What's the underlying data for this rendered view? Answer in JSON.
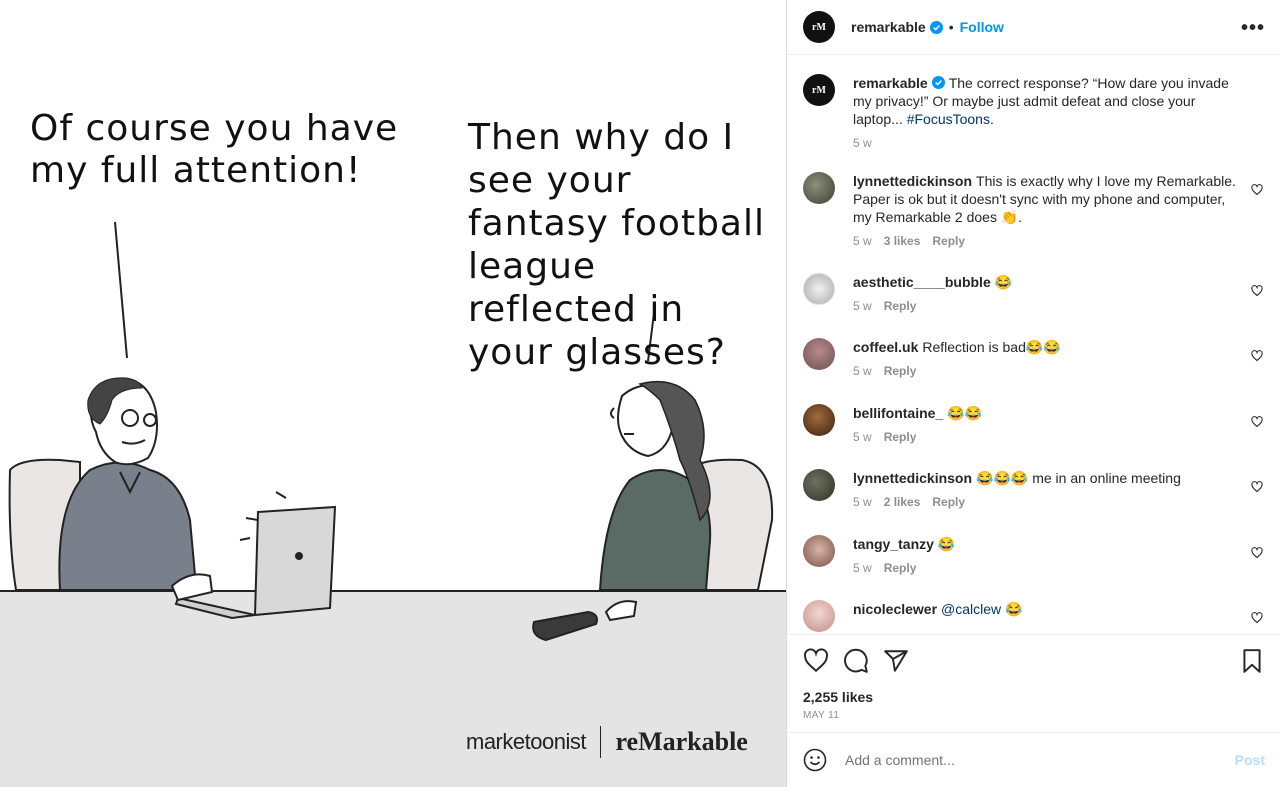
{
  "image": {
    "bubble_left": "Of course you have my full attention!",
    "bubble_right": "Then why do I see your fantasy football league reflected in your glasses?",
    "brand_left": "marketoonist",
    "brand_right": "reMarkable"
  },
  "header": {
    "avatar_text": "rM",
    "username": "remarkable",
    "dot": "•",
    "follow": "Follow",
    "more": "•••"
  },
  "caption": {
    "avatar_text": "rM",
    "username": "remarkable",
    "text": "The correct response? “How dare you invade my privacy!” Or maybe just admit defeat and close your laptop... ",
    "hashtag": "#FocusToons",
    "trail": ".",
    "time": "5 w"
  },
  "comments": [
    {
      "username": "lynnettedickinson",
      "text": "This is exactly why I love my Remarkable. Paper is ok but it doesn't sync with my phone and computer, my Remarkable 2 does 👏.",
      "time": "5 w",
      "likes": "3 likes",
      "reply": "Reply"
    },
    {
      "username": "aesthetic____bubble",
      "text": "😂",
      "time": "5 w",
      "likes": "",
      "reply": "Reply"
    },
    {
      "username": "coffeel.uk",
      "text": "Reflection is bad😂😂",
      "time": "5 w",
      "likes": "",
      "reply": "Reply"
    },
    {
      "username": "bellifontaine_",
      "text": "😂😂",
      "time": "5 w",
      "likes": "",
      "reply": "Reply"
    },
    {
      "username": "lynnettedickinson",
      "text": "😂😂😂 me in an online meeting",
      "time": "5 w",
      "likes": "2 likes",
      "reply": "Reply"
    },
    {
      "username": "tangy_tanzy",
      "text": "😂",
      "time": "5 w",
      "likes": "",
      "reply": "Reply"
    },
    {
      "username": "nicoleclewer",
      "mention": "@calclew",
      "text": " 😂",
      "time": "",
      "likes": "",
      "reply": ""
    }
  ],
  "stats": {
    "likes": "2,255 likes",
    "date": "MAY 11"
  },
  "composer": {
    "placeholder": "Add a comment...",
    "post": "Post"
  },
  "colors": {
    "accent": "#0095f6",
    "hashtag": "#00376b",
    "muted": "#8e8e8e",
    "post_disabled": "#b2dffc"
  }
}
